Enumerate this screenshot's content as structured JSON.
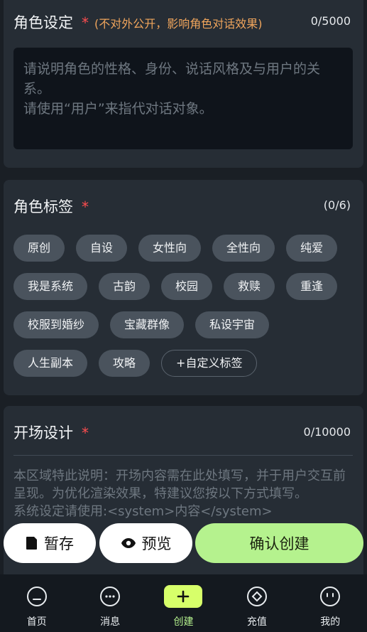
{
  "role_setting": {
    "title": "角色设定",
    "required_mark": "*",
    "hint": "(不对外公开，影响角色对话效果)",
    "counter": "0/5000",
    "placeholder": "请说明角色的性格、身份、说话风格及与用户的关系。\n请使用“用户”来指代对话对象。"
  },
  "role_tags": {
    "title": "角色标签",
    "required_mark": "*",
    "counter": "(0/6)",
    "rows": [
      [
        "原创",
        "自设",
        "女性向",
        "全性向",
        "纯爱"
      ],
      [
        "我是系统",
        "古韵",
        "校园",
        "救赎",
        "重逢"
      ],
      [
        "校服到婚纱",
        "宝藏群像",
        "私设宇宙"
      ],
      [
        "人生副本",
        "攻略"
      ]
    ],
    "custom_label": "+自定义标签"
  },
  "opening": {
    "title": "开场设计",
    "required_mark": "*",
    "counter": "0/10000",
    "placeholder": "本区域特此说明：开场内容需在此处填写，并于用户交互前呈现。为优化渲染效果，特建议您按以下方式填写。\n系统设定请使用:<system>内容</system>"
  },
  "actions": {
    "save": "暂存",
    "preview": "预览",
    "confirm": "确认创建"
  },
  "nav": [
    {
      "label": "首页",
      "icon": "home-icon",
      "active": false
    },
    {
      "label": "消息",
      "icon": "message-icon",
      "active": false
    },
    {
      "label": "创建",
      "icon": "plus-icon",
      "active": true
    },
    {
      "label": "充值",
      "icon": "diamond-icon",
      "active": false
    },
    {
      "label": "我的",
      "icon": "profile-icon",
      "active": false
    }
  ],
  "colors": {
    "accent": "#b5f28e",
    "required": "#ff4d4f",
    "hint": "#f0a55c",
    "card": "#262d35",
    "background": "#1a1f25"
  }
}
